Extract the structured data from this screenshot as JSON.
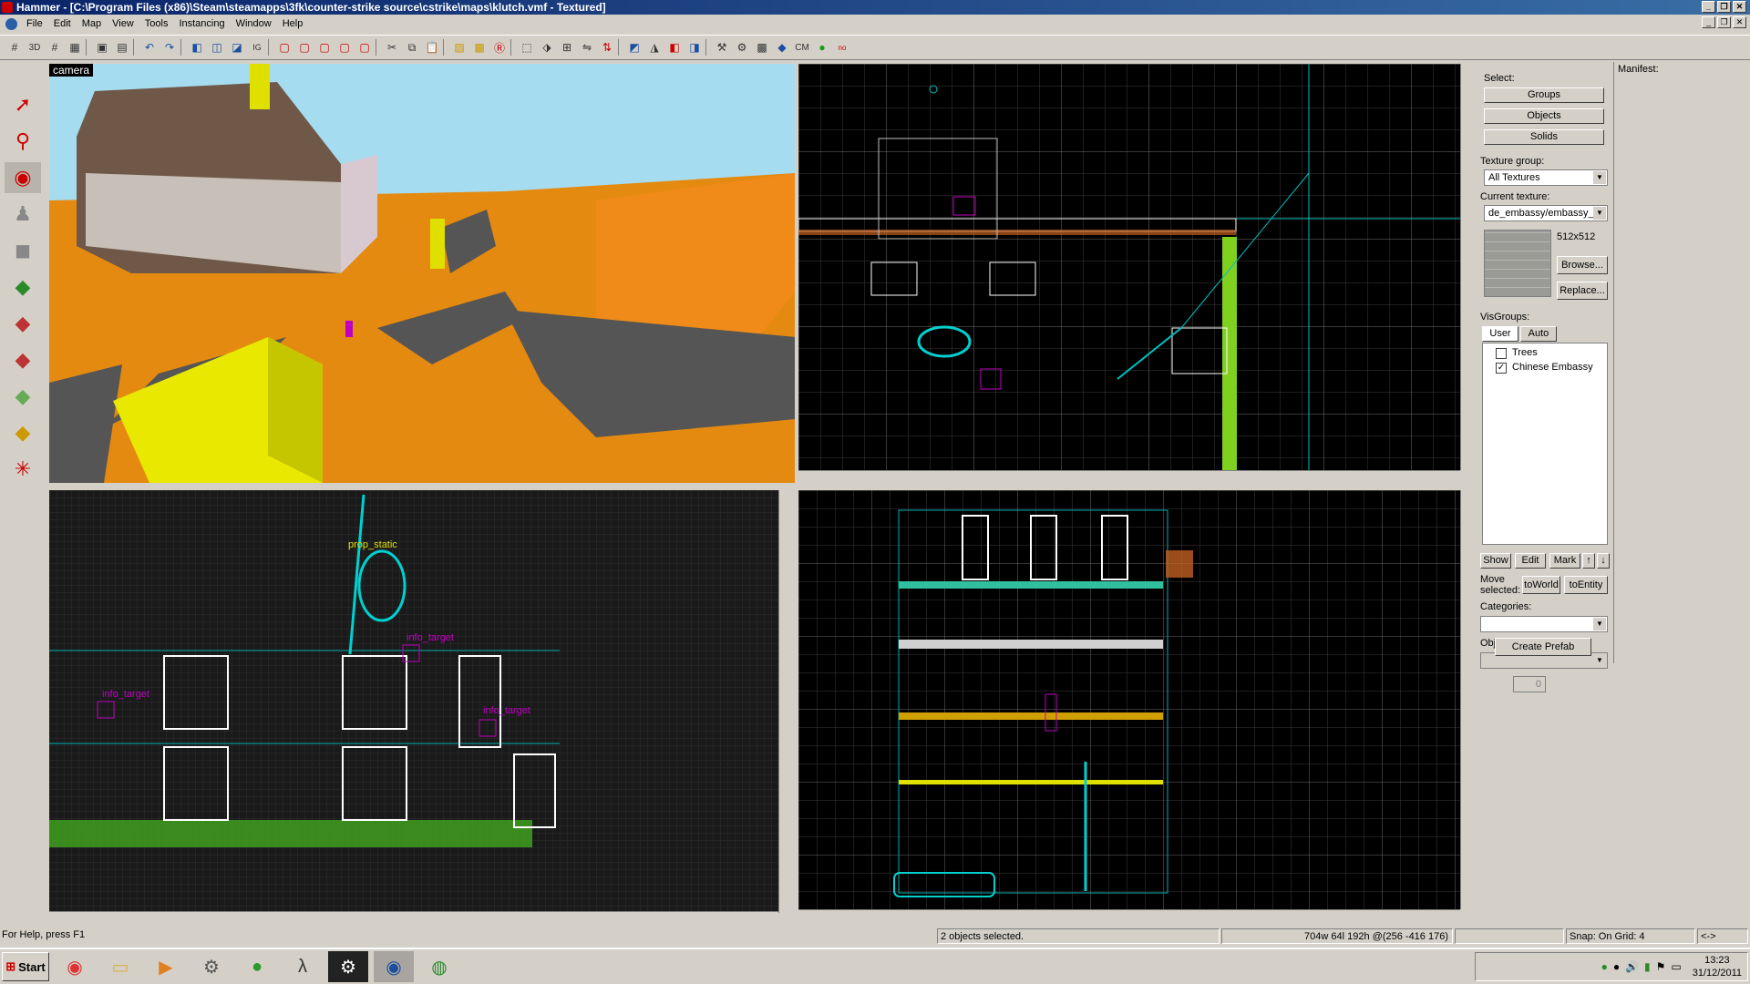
{
  "window": {
    "title": "Hammer - [C:\\Program Files (x86)\\Steam\\steamapps\\3fk\\counter-strike source\\cstrike\\maps\\klutch.vmf - Textured]"
  },
  "menu": [
    "File",
    "Edit",
    "Map",
    "View",
    "Tools",
    "Instancing",
    "Window",
    "Help"
  ],
  "toolbar": {
    "icons": [
      "grid-icon",
      "3d-grid-icon",
      "grid-small-icon",
      "grid-large-icon",
      "group-icon",
      "ungroup-icon",
      "undo-icon",
      "redo-icon",
      "carve-icon",
      "vis-icon",
      "hollow-icon",
      "cut-icon",
      "copy-icon",
      "paste-icon",
      "texture-lock-icon",
      "hide-icon",
      "run-map-icon"
    ],
    "cm_label": "CM"
  },
  "viewports": {
    "camera_label": "camera",
    "side_labels": [
      "prop_static",
      "info_target",
      "info_target",
      "info_target"
    ]
  },
  "select_panel": {
    "select_label": "Select:",
    "groups_btn": "Groups",
    "objects_btn": "Objects",
    "solids_btn": "Solids",
    "texture_group_label": "Texture group:",
    "texture_group_value": "All Textures",
    "current_texture_label": "Current texture:",
    "current_texture_value": "de_embassy/embassy_",
    "texture_size": "512x512",
    "browse_btn": "Browse...",
    "replace_btn": "Replace...",
    "visgroups_label": "VisGroups:",
    "tab_user": "User",
    "tab_auto": "Auto",
    "visgroups": [
      {
        "name": "Trees",
        "checked": false
      },
      {
        "name": "Chinese Embassy",
        "checked": true
      }
    ],
    "show_btn": "Show",
    "edit_btn": "Edit",
    "mark_btn": "Mark",
    "move_selected_label": "Move selected:",
    "toworld_btn": "toWorld",
    "toentity_btn": "toEntity",
    "categories_label": "Categories:",
    "objects_label": "Objects:",
    "objects_count": "0",
    "create_prefab_btn": "Create Prefab"
  },
  "manifest": {
    "label": "Manifest:"
  },
  "status": {
    "help": "For Help, press F1",
    "selection": "2 objects selected.",
    "coords": "704w 64l 192h @(256 -416 176)",
    "snap": "Snap: On Grid: 4",
    "arrows": "<->"
  },
  "taskbar": {
    "start": "Start",
    "apps": [
      "chrome-icon",
      "folder-icon",
      "media-player-icon",
      "steam-icon",
      "spotify-icon",
      "half-life-icon",
      "steam-dark-icon",
      "hammer-icon",
      "world-icon"
    ],
    "time": "13:23",
    "date": "31/12/2011"
  }
}
